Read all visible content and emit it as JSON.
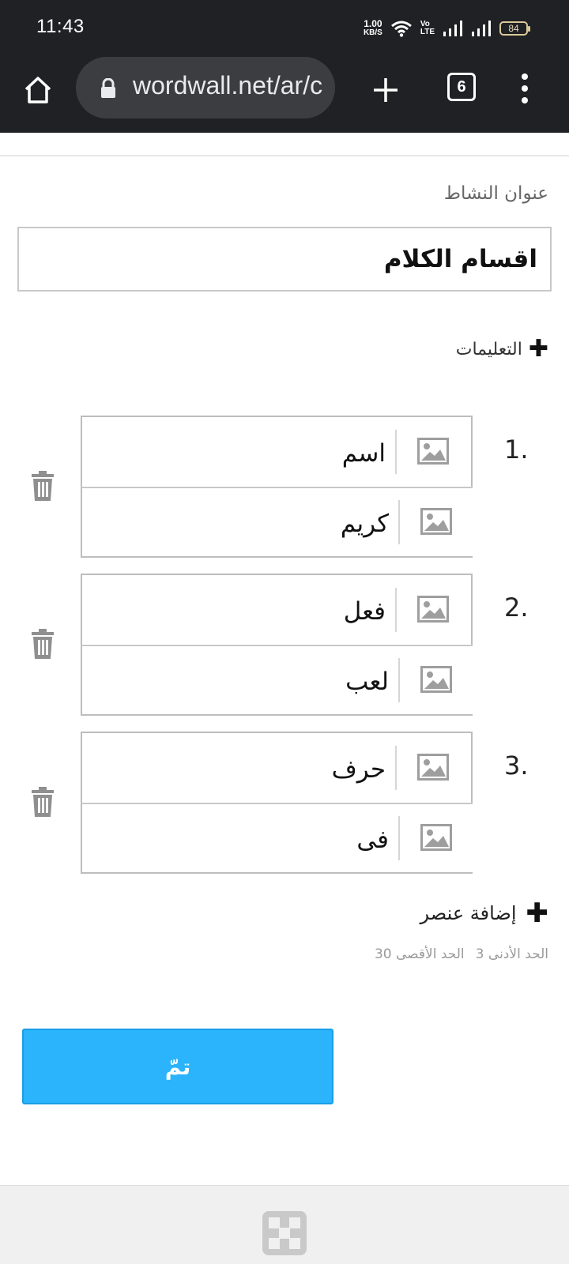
{
  "status_bar": {
    "time": "11:43",
    "net_speed_value": "1.00",
    "net_speed_unit": "KB/S",
    "volte_top": "Vo",
    "volte_bottom": "LTE",
    "battery": "84"
  },
  "browser": {
    "url": "wordwall.net/ar/c",
    "tab_count": "6",
    "icons": [
      "home-icon",
      "lock-icon",
      "plus-icon",
      "tabs-icon",
      "more-vert-icon"
    ]
  },
  "form": {
    "activity_title_label": "عنوان النشاط",
    "activity_title_value": "اقسام الكلام",
    "instructions_label": "التعليمات",
    "items": [
      {
        "number": "1.",
        "first": "اسم",
        "second": "كريم"
      },
      {
        "number": "2.",
        "first": "فعل",
        "second": "لعب"
      },
      {
        "number": "3.",
        "first": "حرف",
        "second": "فى"
      }
    ],
    "add_item_label": "إضافة عنصر",
    "min_label": "الحد الأدنى 3",
    "max_label": "الحد الأقصى 30",
    "done_label": "تمّ"
  },
  "colors": {
    "primary_button": "#2bb4fb",
    "chrome_bar": "#202124"
  }
}
